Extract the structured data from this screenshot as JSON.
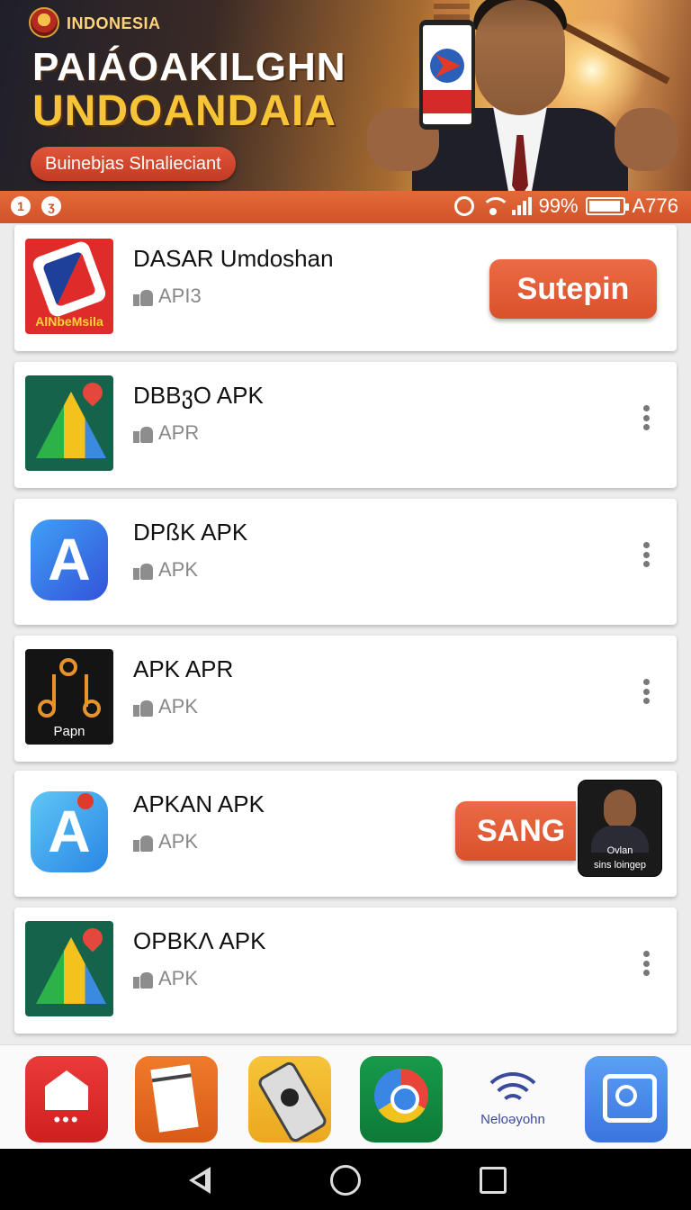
{
  "banner": {
    "brand": "INDONESIA",
    "headline_line1": "PAIÁOAKILGHN",
    "headline_line2": "UNDOANDAIA",
    "subtitle": "Buinebjas Slnalieciant"
  },
  "statusbar": {
    "notif_1": "1",
    "notif_2": "ʒ",
    "battery_percent": "99%",
    "clock": "A776"
  },
  "apps": [
    {
      "name": "DASAR Umdoshan",
      "meta": "API3",
      "icon": "tag-icon",
      "icon_caption": "AlNbeMsila",
      "action": "Sutepin"
    },
    {
      "name": "DBBვO APK",
      "meta": "APR",
      "icon": "maps-icon"
    },
    {
      "name": "DPßK APK",
      "meta": "APK",
      "icon": "blue-a-icon"
    },
    {
      "name": "APK  APR",
      "meta": "APK",
      "icon": "network-icon",
      "icon_caption": "Papn"
    },
    {
      "name": "APKAN APK",
      "meta": "APK",
      "icon": "light-a-icon",
      "action": "SANG",
      "promo_line1": "Ovlan",
      "promo_line2": "sins loingep"
    },
    {
      "name": "OPBKΛ APK",
      "meta": "APK",
      "icon": "maps-icon"
    }
  ],
  "dock": {
    "items": [
      {
        "icon": "store-icon"
      },
      {
        "icon": "document-icon"
      },
      {
        "icon": "phone-device-icon"
      },
      {
        "icon": "chrome-icon"
      },
      {
        "icon": "wifi-icon",
        "label": "Neloəyohn"
      },
      {
        "icon": "camera-icon"
      }
    ]
  },
  "colors": {
    "accent": "#d9512c",
    "button": "#eb6b44"
  }
}
